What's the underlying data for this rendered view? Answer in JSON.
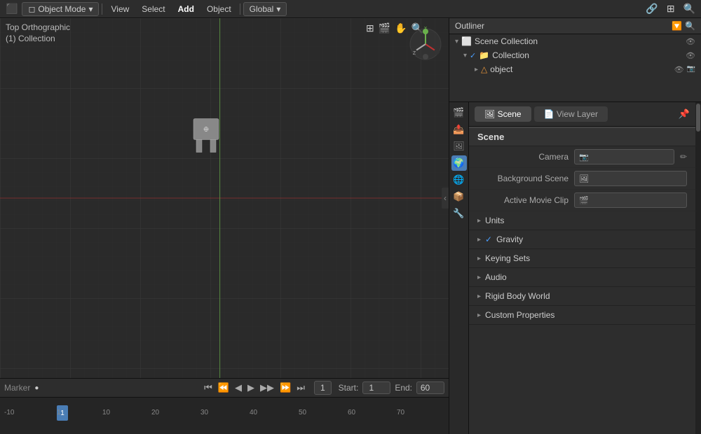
{
  "topbar": {
    "editor_icon": "⬛",
    "mode_label": "Object Mode",
    "menu_items": [
      "View",
      "Select",
      "Add",
      "Object"
    ],
    "transform_label": "Global",
    "right_icons": [
      "🔗",
      "⊞",
      "🔍"
    ]
  },
  "viewport": {
    "label": "Top Orthographic",
    "collection": "(1) Collection",
    "axis_y_color": "#6ab04c",
    "axis_x_color": "#c0303030",
    "toolbar_icons": [
      "⊞",
      "🎬",
      "✋",
      "🔍"
    ],
    "right_toolbar": [
      "⊞",
      "🎬",
      "✋",
      "🔍",
      "⊕"
    ]
  },
  "timeline": {
    "marker_label": "Marker",
    "playback_controls": [
      "⏮",
      "⏪",
      "◀",
      "▶",
      "▶▶",
      "⏩",
      "⏭"
    ],
    "current_frame": "1",
    "start_label": "Start:",
    "start_frame": "1",
    "end_label": "End:",
    "end_frame": "60",
    "ruler_marks": [
      "-10",
      "1",
      "10",
      "20",
      "30",
      "40",
      "50",
      "60",
      "70"
    ]
  },
  "outliner": {
    "title": "Outliner",
    "items": [
      {
        "level": 0,
        "expanded": true,
        "icon": "🗂",
        "label": "Scene Collection",
        "show_eye": true
      },
      {
        "level": 1,
        "expanded": true,
        "icon": "📁",
        "label": "Collection",
        "checked": true,
        "show_eye": true
      },
      {
        "level": 2,
        "expanded": false,
        "icon": "△",
        "label": "object",
        "show_eye": true,
        "extra_icon": "🔗"
      }
    ]
  },
  "properties": {
    "left_icons": [
      {
        "icon": "🎬",
        "label": "render",
        "active": false
      },
      {
        "icon": "📤",
        "label": "output",
        "active": false
      },
      {
        "icon": "👁",
        "label": "view-layer",
        "active": false
      },
      {
        "icon": "🖼",
        "label": "scene",
        "active": true
      },
      {
        "icon": "🌍",
        "label": "world",
        "active": false
      },
      {
        "icon": "📦",
        "label": "object",
        "active": false
      },
      {
        "icon": "🔧",
        "label": "modifier",
        "active": false
      }
    ],
    "tabs": {
      "scene_label": "Scene",
      "scene_icon": "🖼",
      "view_layer_label": "View Layer",
      "view_layer_icon": "📄",
      "active_tab": "scene"
    },
    "section_scene": "Scene",
    "camera_label": "Camera",
    "camera_value": "",
    "background_scene_label": "Background Scene",
    "background_scene_value": "",
    "active_movie_clip_label": "Active Movie Clip",
    "active_movie_clip_value": "",
    "sections": [
      {
        "id": "units",
        "label": "Units",
        "expanded": false,
        "has_check": false
      },
      {
        "id": "gravity",
        "label": "Gravity",
        "expanded": false,
        "has_check": true,
        "checked": true
      },
      {
        "id": "keying-sets",
        "label": "Keying Sets",
        "expanded": false,
        "has_check": false
      },
      {
        "id": "audio",
        "label": "Audio",
        "expanded": false,
        "has_check": false
      },
      {
        "id": "rigid-body-world",
        "label": "Rigid Body World",
        "expanded": false,
        "has_check": false
      },
      {
        "id": "custom-properties",
        "label": "Custom Properties",
        "expanded": false,
        "has_check": false
      }
    ]
  }
}
